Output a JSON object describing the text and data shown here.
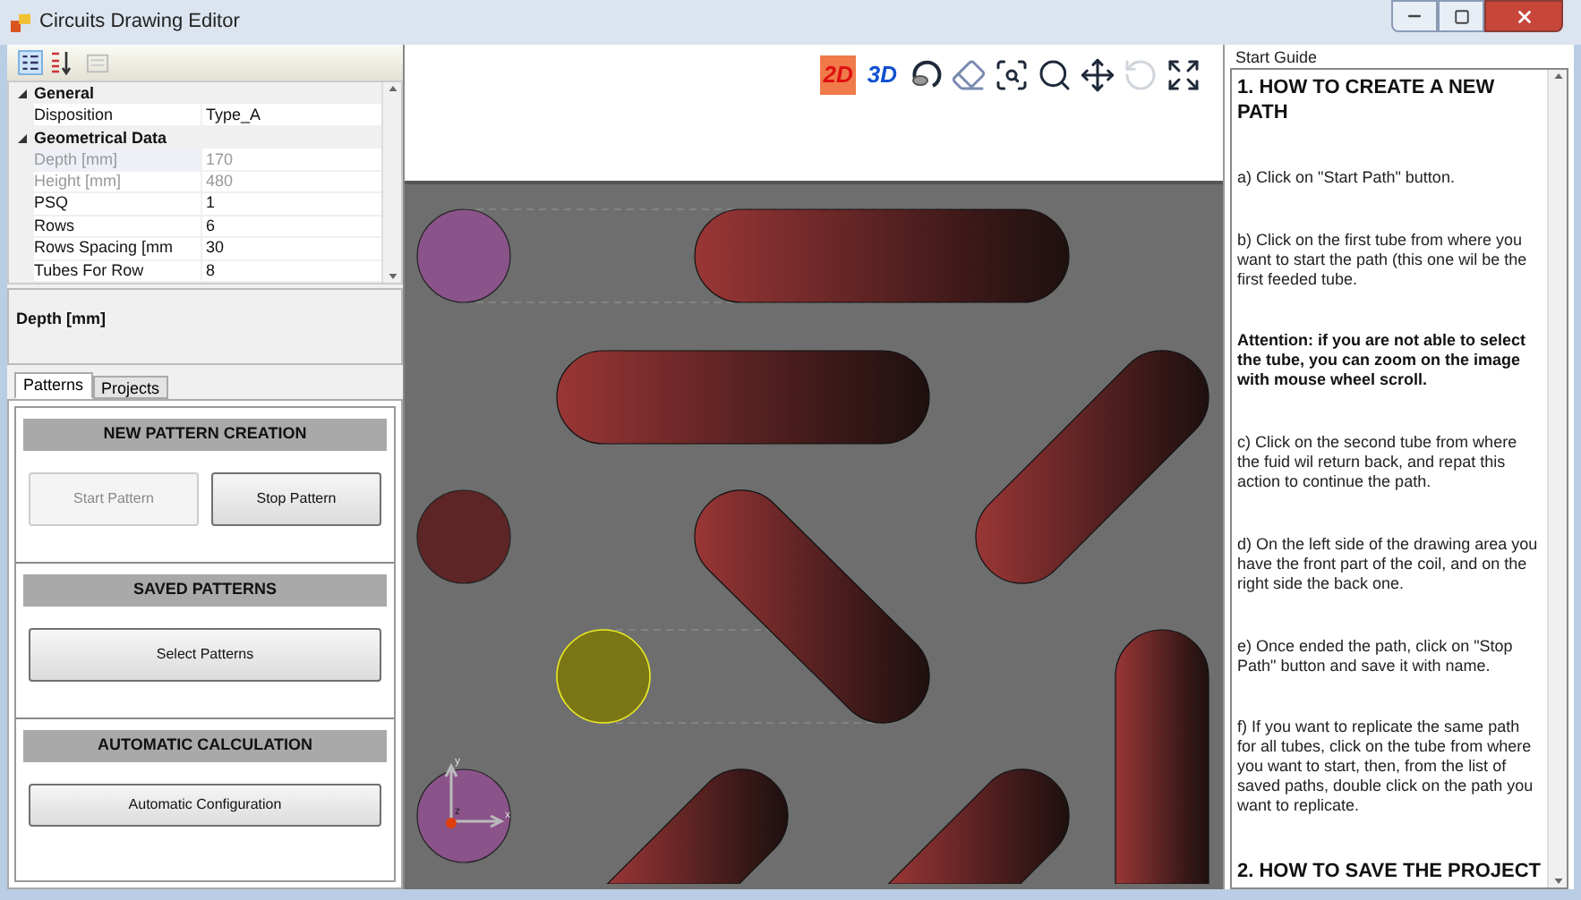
{
  "window": {
    "title": "Circuits Drawing Editor"
  },
  "property_grid": {
    "categories": [
      {
        "name": "General",
        "expanded": true,
        "properties": [
          {
            "name": "Disposition",
            "value": "Type_A",
            "disabled": false,
            "selected": false
          }
        ]
      },
      {
        "name": "Geometrical Data",
        "expanded": true,
        "properties": [
          {
            "name": "Depth [mm]",
            "value": "170",
            "disabled": true,
            "selected": true
          },
          {
            "name": "Height [mm]",
            "value": "480",
            "disabled": true,
            "selected": false
          },
          {
            "name": "PSQ",
            "value": "1",
            "disabled": false,
            "selected": false
          },
          {
            "name": "Rows",
            "value": "6",
            "disabled": false,
            "selected": false
          },
          {
            "name": "Rows Spacing [mm",
            "value": "30",
            "disabled": false,
            "selected": false
          },
          {
            "name": "Tubes For Row",
            "value": "8",
            "disabled": false,
            "selected": false
          }
        ]
      }
    ],
    "description": "Depth [mm]"
  },
  "tabs": [
    {
      "label": "Patterns",
      "selected": true
    },
    {
      "label": "Projects",
      "selected": false
    }
  ],
  "sections": [
    {
      "title": "NEW PATTERN CREATION",
      "buttons": [
        {
          "label": "Start Pattern",
          "disabled": true
        },
        {
          "label": "Stop Pattern",
          "disabled": false
        }
      ]
    },
    {
      "title": "SAVED PATTERNS",
      "buttons": [
        {
          "label": "Select Patterns",
          "disabled": false
        }
      ]
    },
    {
      "title": "AUTOMATIC CALCULATION",
      "buttons": [
        {
          "label": "Automatic Configuration",
          "disabled": false
        }
      ]
    }
  ],
  "view_toolbar": {
    "modes": [
      {
        "label": "2D",
        "selected": true
      },
      {
        "label": "3D",
        "selected": false
      }
    ],
    "tools": [
      {
        "kind": "orbit",
        "disabled": false
      },
      {
        "kind": "eraser",
        "disabled": false
      },
      {
        "kind": "zoom-window",
        "disabled": false
      },
      {
        "kind": "zoom",
        "disabled": false
      },
      {
        "kind": "pan",
        "disabled": false
      },
      {
        "kind": "rotate",
        "disabled": true
      },
      {
        "kind": "fullscreen",
        "disabled": false
      }
    ]
  },
  "canvas": {
    "axis_labels": [
      "y",
      "z",
      "x"
    ]
  },
  "guide": {
    "title": "Start Guide",
    "paragraphs": [
      {
        "kind": "heading",
        "text": "1. HOW TO CREATE A NEW PATH"
      },
      {
        "kind": "text",
        "text": "a) Click on \"Start Path\" button."
      },
      {
        "kind": "text",
        "text": "b) Click on the first tube from where you want to start the path (this one wil be the first feeded tube."
      },
      {
        "kind": "bold",
        "text": "Attention: if you are not able to select the tube, you can zoom on the image with mouse wheel scroll."
      },
      {
        "kind": "text",
        "text": "c) Click on the second tube from where the fuid wil return back, and repat this action to continue the path."
      },
      {
        "kind": "text",
        "text": "d) On the left side of the drawing area you have the front part of the coil, and on the right side the back one."
      },
      {
        "kind": "text",
        "text": "e) Once ended the path, click on \"Stop Path\" button and save it with name."
      },
      {
        "kind": "text",
        "text": "f) If you want to replicate the same path for all tubes, click on the tube from where you want to start, then, from the list of saved paths, double click on the path you want to replicate."
      },
      {
        "kind": "heading",
        "text": "2. HOW TO SAVE THE PROJECT"
      }
    ]
  }
}
